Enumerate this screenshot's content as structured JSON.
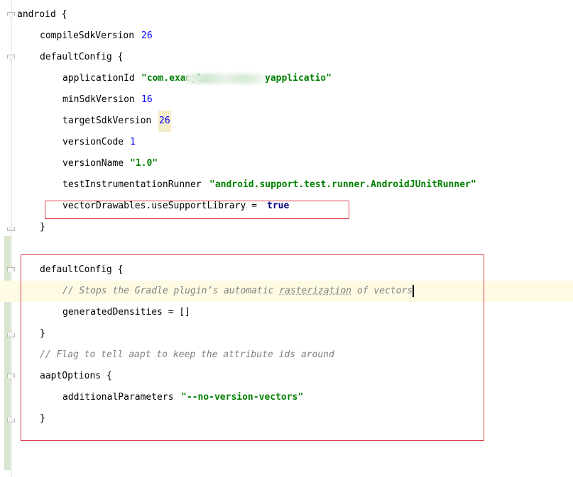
{
  "editor": {
    "lines": {
      "l1": {
        "text": "android {"
      },
      "l2": {
        "key": "compileSdkVersion",
        "value": "26"
      },
      "l3": {
        "text": "defaultConfig {"
      },
      "l4": {
        "key": "applicationId",
        "value_prefix": "\"com.exampl",
        "value_suffix": "yapplicatio\""
      },
      "l5": {
        "key": "minSdkVersion",
        "value": "16"
      },
      "l6": {
        "key": "targetSdkVersion",
        "value": "26"
      },
      "l7": {
        "key": "versionCode",
        "value": "1"
      },
      "l8": {
        "key": "versionName",
        "value": "\"1.0\""
      },
      "l9": {
        "key": "testInstrumentationRunner",
        "value": "\"android.support.test.runner.AndroidJUnitRunner\""
      },
      "l10": {
        "key": "vectorDrawables.useSupportLibrary =",
        "value": "true"
      },
      "l11": {
        "text": "}"
      },
      "l13": {
        "text": "defaultConfig {"
      },
      "l14": {
        "comment_a": "// Stops the Gradle plugin’s automatic ",
        "comment_b": "rasterization",
        "comment_c": " of vectors"
      },
      "l15": {
        "text": "generatedDensities = []"
      },
      "l16": {
        "text": "}"
      },
      "l17": {
        "comment": "// Flag to tell aapt to keep the attribute ids around"
      },
      "l18": {
        "text": "aaptOptions {"
      },
      "l19": {
        "key": "additionalParameters",
        "value": "\"--no-version-vectors\""
      },
      "l20": {
        "text": "}"
      }
    }
  },
  "colors": {
    "keyword_number": "#0000ff",
    "string": "#008000",
    "boolean": "#000080",
    "comment": "#808080",
    "highlight_box": "#d9404a"
  }
}
